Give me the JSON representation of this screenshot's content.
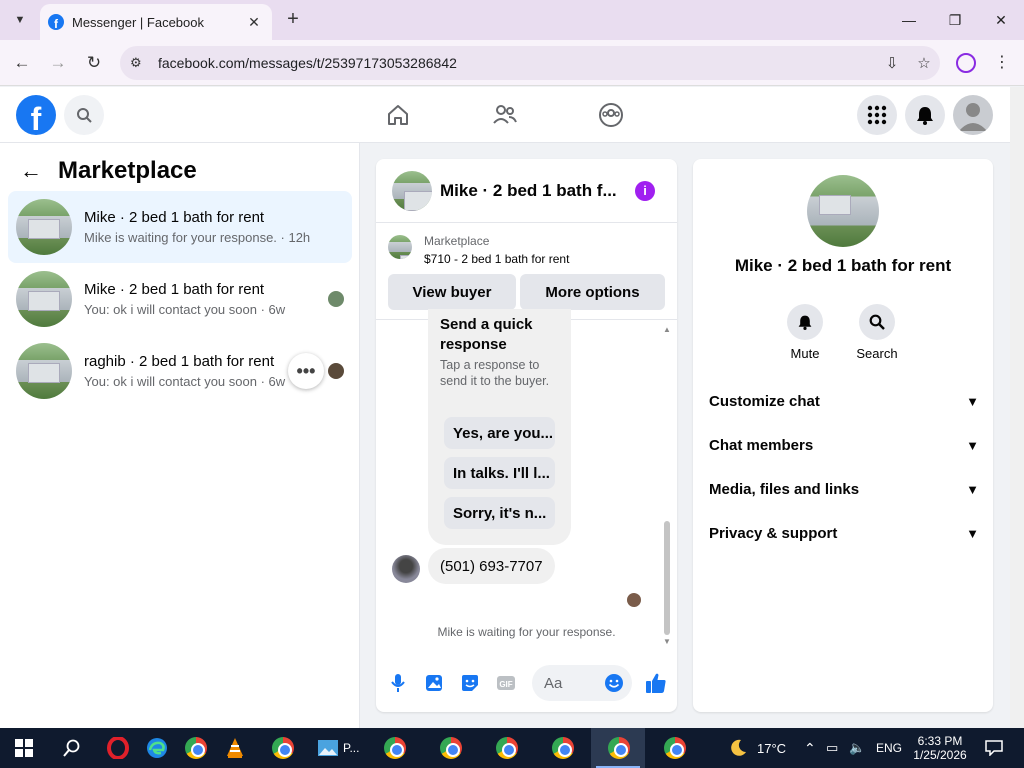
{
  "browser": {
    "tab_title": "Messenger | Facebook",
    "url": "facebook.com/messages/t/25397173053286842"
  },
  "left_panel": {
    "title": "Marketplace",
    "conversations": [
      {
        "name": "Mike · 2 bed 1 bath for rent",
        "snippet": "Mike is waiting for your response. · 12h",
        "active": true
      },
      {
        "name": "Mike · 2 bed 1 bath for rent",
        "snippet": "You: ok i will contact you soon · 6w",
        "active": false
      },
      {
        "name": "raghib · 2 bed 1 bath for rent",
        "snippet": "You: ok i will contact you soon · 6w",
        "active": false
      }
    ]
  },
  "chat": {
    "header_name": "Mike · 2 bed 1 bath f...",
    "marketplace_label": "Marketplace",
    "listing": "$710 - 2 bed 1 bath for rent",
    "view_buyer": "View buyer",
    "more_options": "More options",
    "quick_response_title": "Send a quick response",
    "quick_response_sub": "Tap a response to send it to the buyer.",
    "quick_replies": [
      "Yes, are you...",
      "In talks. I'll l...",
      "Sorry, it's n..."
    ],
    "phone_message": "(501) 693-7707",
    "waiting": "Mike is waiting for your response.",
    "input_placeholder": "Aa"
  },
  "right_panel": {
    "name": "Mike · 2 bed 1 bath for rent",
    "mute": "Mute",
    "search": "Search",
    "sections": [
      "Customize chat",
      "Chat members",
      "Media, files and links",
      "Privacy & support"
    ]
  },
  "taskbar": {
    "photos_label": "P...",
    "weather": "17°C",
    "lang": "ENG",
    "time": "6:33 PM",
    "date": "1/25/2026"
  },
  "colors": {
    "fb_blue": "#1877f2",
    "info_purple": "#a020f0"
  }
}
